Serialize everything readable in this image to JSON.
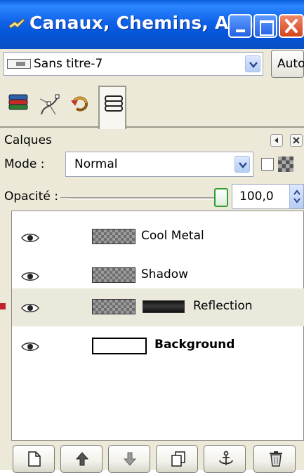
{
  "window": {
    "title": "Canaux, Chemins, Ann...",
    "controls": [
      "minimize",
      "maximize",
      "close"
    ]
  },
  "image_selector": {
    "value": "Sans titre-7",
    "auto_label": "Auto"
  },
  "tabs": [
    {
      "icon": "layers-stack-icon",
      "active": false
    },
    {
      "icon": "paths-icon",
      "active": false
    },
    {
      "icon": "undo-history-icon",
      "active": false
    },
    {
      "icon": "layers-outline-icon",
      "active": true
    }
  ],
  "layers_panel": {
    "title": "Calques",
    "mode_label": "Mode :",
    "mode_value": "Normal",
    "opacity_label": "Opacité :",
    "opacity_value": "100,0",
    "opacity_level": 1.0,
    "keep_transparency": false
  },
  "layers": [
    {
      "name": "Cool Metal",
      "visible": true,
      "selected": false,
      "bold": false,
      "has_mask": false,
      "thumbnail": "checker"
    },
    {
      "name": "Shadow",
      "visible": true,
      "selected": false,
      "bold": false,
      "has_mask": false,
      "thumbnail": "checker"
    },
    {
      "name": "Reflection",
      "visible": true,
      "selected": true,
      "bold": false,
      "has_mask": true,
      "thumbnail": "checker"
    },
    {
      "name": "Background",
      "visible": true,
      "selected": false,
      "bold": true,
      "has_mask": false,
      "thumbnail": "white"
    }
  ],
  "toolbar": {
    "buttons": [
      "new-layer",
      "raise-layer",
      "lower-layer",
      "duplicate-layer",
      "anchor-layer",
      "delete-layer"
    ]
  },
  "colors": {
    "titlebar": "#0a55d8",
    "background": "#ece9d8",
    "selected_row": "#ebe8dc",
    "slider_green": "#2f9e2f"
  }
}
